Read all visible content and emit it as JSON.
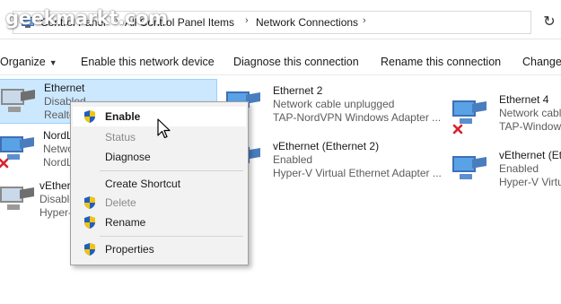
{
  "watermark": "geekmarkt.com",
  "address": {
    "crumbs": [
      "Control Panel",
      "All Control Panel Items",
      "Network Connections"
    ],
    "separator": "›",
    "refresh_glyph": "↻"
  },
  "toolbar": {
    "organize": "Organize",
    "enable": "Enable this network device",
    "diagnose": "Diagnose this connection",
    "rename": "Rename this connection",
    "change": "Change"
  },
  "adapters": [
    {
      "name": "Ethernet",
      "line1": "Disabled",
      "line2": "Realtek"
    },
    {
      "name": "NordLy",
      "line1": "Network",
      "line2": "NordLy"
    },
    {
      "name": "vEthern",
      "line1": "Disable",
      "line2": "Hyper-V"
    },
    {
      "name": "Ethernet 2",
      "line1": "Network cable unplugged",
      "line2": "TAP-NordVPN Windows Adapter ..."
    },
    {
      "name": "vEthernet (Ethernet 2)",
      "line1": "Enabled",
      "line2": "Hyper-V Virtual Ethernet Adapter ..."
    },
    {
      "name": "Ethernet 4",
      "line1": "Network cable",
      "line2": "TAP-Window"
    },
    {
      "name": "vEthernet (Et",
      "line1": "Enabled",
      "line2": "Hyper-V Virtu"
    }
  ],
  "context_menu": {
    "items": [
      {
        "label": "Enable",
        "shield": true,
        "bold": true,
        "disabled": false
      },
      {
        "label": "Status",
        "shield": false,
        "bold": false,
        "disabled": true
      },
      {
        "label": "Diagnose",
        "shield": false,
        "bold": false,
        "disabled": false
      },
      {
        "label": "Create Shortcut",
        "shield": false,
        "bold": false,
        "disabled": false
      },
      {
        "label": "Delete",
        "shield": true,
        "bold": false,
        "disabled": true
      },
      {
        "label": "Rename",
        "shield": true,
        "bold": false,
        "disabled": false
      },
      {
        "label": "Properties",
        "shield": true,
        "bold": false,
        "disabled": false
      }
    ]
  },
  "icons": {
    "adapter": "network-adapter-icon",
    "disabled_badge": "red-x-icon",
    "shield": "uac-shield-icon",
    "address": "control-panel-icon"
  },
  "colors": {
    "selection_bg": "#cce8ff",
    "selection_border": "#99d1ff",
    "menu_bg": "#f2f2f2",
    "hover_bg": "#ffffff",
    "disabled_text": "#8a8a8a",
    "error_red": "#d9232e"
  }
}
